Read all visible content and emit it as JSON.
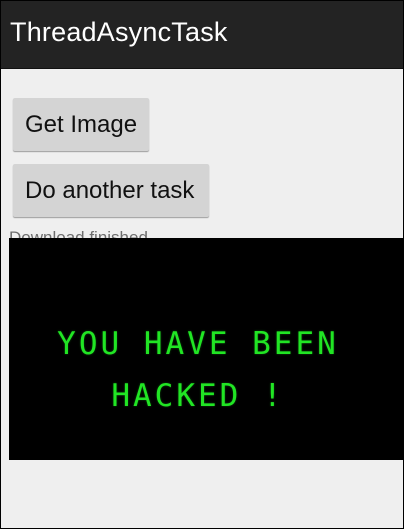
{
  "app": {
    "title": "ThreadAsyncTask"
  },
  "buttons": {
    "get_image": "Get Image",
    "another_task": "Do another task"
  },
  "status": {
    "message": "Download finished"
  },
  "image": {
    "line_1": "YOU HAVE BEEN",
    "line_2": "HACKED !",
    "text_color": "#21e524",
    "background_color": "#000000"
  },
  "colors": {
    "action_bar": "#232323",
    "screen_background": "#efefef",
    "button_background": "#d4d4d4",
    "status_text": "#6e6e6e"
  }
}
